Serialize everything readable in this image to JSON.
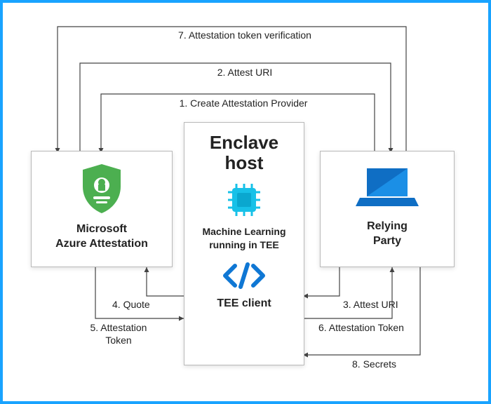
{
  "boxes": {
    "attestation_title_l1": "Microsoft",
    "attestation_title_l2": "Azure Attestation",
    "enclave_title_l1": "Enclave",
    "enclave_title_l2": "host",
    "enclave_ml_l1": "Machine Learning",
    "enclave_ml_l2": "running in TEE",
    "enclave_tee_client": "TEE client",
    "relying_l1": "Relying",
    "relying_l2": "Party"
  },
  "steps": {
    "s1": "1. Create Attestation Provider",
    "s2": "2. Attest URI",
    "s3": "3. Attest URI",
    "s4": "4. Quote",
    "s5_l1": "5. Attestation",
    "s5_l2": "Token",
    "s6": "6. Attestation Token",
    "s7": "7. Attestation token verification",
    "s8": "8. Secrets"
  },
  "colors": {
    "green": "#4caf50",
    "azure_blue": "#0f77d4",
    "cyan": "#17c1e8"
  }
}
